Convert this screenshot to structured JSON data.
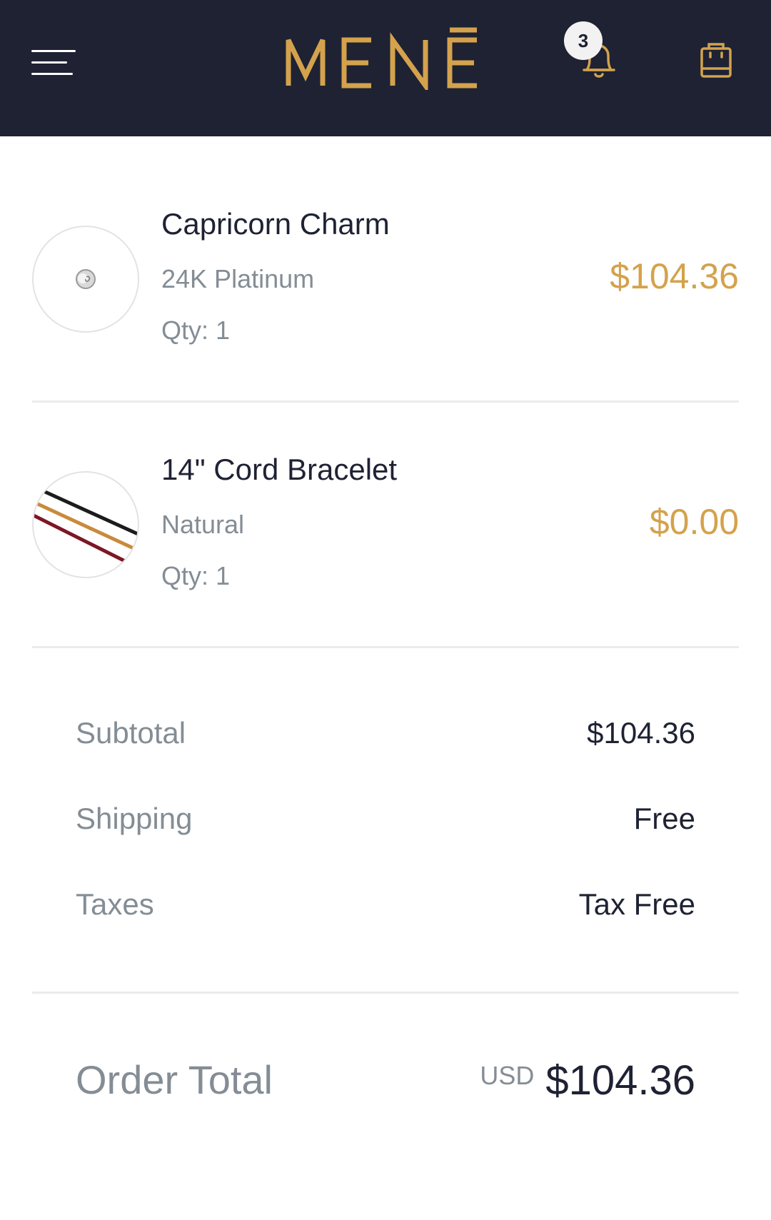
{
  "header": {
    "brand": "MENĒ",
    "notification_count": "3",
    "colors": {
      "background": "#1e2233",
      "accent": "#d4a24c"
    },
    "icons": {
      "menu": "menu-icon",
      "notifications": "bell-icon",
      "cart": "shopping-bag-icon"
    }
  },
  "cart": {
    "items": [
      {
        "name": "Capricorn Charm",
        "variant": "24K Platinum",
        "qty": "Qty: 1",
        "price": "$104.36"
      },
      {
        "name": "14\" Cord Bracelet",
        "variant": "Natural",
        "qty": "Qty: 1",
        "price": "$0.00"
      }
    ]
  },
  "summary": {
    "subtotal_label": "Subtotal",
    "subtotal_value": "$104.36",
    "shipping_label": "Shipping",
    "shipping_value": "Free",
    "taxes_label": "Taxes",
    "taxes_value": "Tax Free"
  },
  "order_total": {
    "label": "Order Total",
    "currency": "USD",
    "amount": "$104.36"
  }
}
